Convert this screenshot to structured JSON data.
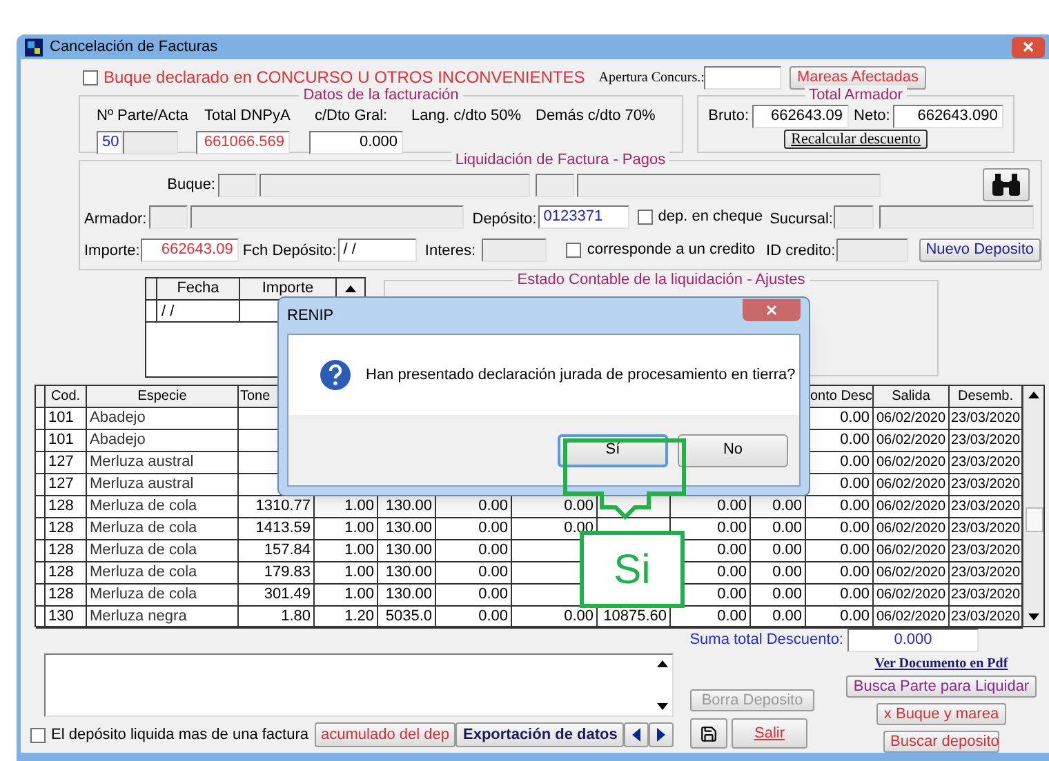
{
  "window": {
    "title": "Cancelación de Facturas"
  },
  "top_bar": {
    "concurso": {
      "label": "Buque declarado en CONCURSO U OTROS INCONVENIENTES",
      "checked": false
    },
    "apertura_label": "Apertura Concurs.:",
    "mareas_button": "Mareas Afectadas"
  },
  "datos_facturacion": {
    "title": "Datos de la facturación",
    "labels": [
      "Nº Parte/Acta",
      "Total DNPyA",
      "c/Dto Gral:",
      "Lang. c/dto 50%",
      "Demás c/dto 70%"
    ],
    "parte": "50",
    "total_dnpya": "661066.569",
    "dto_gral": "0.000"
  },
  "total_armador": {
    "title": "Total Armador",
    "bruto_label": "Bruto:",
    "bruto": "662643.09",
    "neto_label": "Neto:",
    "neto": "662643.090",
    "recalcular_button": "Recalcular descuento"
  },
  "pagos": {
    "title": "Liquidación de Factura - Pagos",
    "buque_label": "Buque:",
    "armador_label": "Armador:",
    "deposito_label": "Depósito:",
    "deposito": "0123371",
    "cheque": {
      "label": "dep. en cheque",
      "checked": false
    },
    "sucursal_label": "Sucursal:",
    "importe_label": "Importe:",
    "importe": "662643.09",
    "fecha_label": "Fch Depósito:",
    "fecha": "/ /",
    "interes_label": "Interes:",
    "credito": {
      "label": "corresponde a un credito",
      "checked": false
    },
    "id_credito_label": "ID credito:",
    "nuevo_button": "Nuevo Deposito"
  },
  "deposit_grid": {
    "columns": [
      "Fecha",
      "Importe"
    ],
    "rows": [
      {
        "fecha": "/ /"
      }
    ]
  },
  "ajustes": {
    "title": "Estado Contable de la liquidación - Ajustes"
  },
  "table": {
    "columns": [
      {
        "label": "Cod."
      },
      {
        "label": "Especie"
      },
      {
        "label": "Tone"
      },
      {},
      {},
      {},
      {},
      {},
      {},
      {},
      {
        "label": "onto Desc"
      },
      {
        "label": "Salida"
      },
      {
        "label": "Desemb."
      }
    ],
    "rows": [
      {
        "cod": "101",
        "especie": "Abadejo",
        "monto": "0.00",
        "salida": "06/02/2020",
        "desemb": "23/03/2020"
      },
      {
        "cod": "101",
        "especie": "Abadejo",
        "monto": "0.00",
        "salida": "06/02/2020",
        "desemb": "23/03/2020"
      },
      {
        "cod": "127",
        "especie": "Merluza austral",
        "monto": "0.00",
        "salida": "06/02/2020",
        "desemb": "23/03/2020"
      },
      {
        "cod": "127",
        "especie": "Merluza austral",
        "monto": "0.00",
        "salida": "06/02/2020",
        "desemb": "23/03/2020"
      },
      {
        "cod": "128",
        "especie": "Merluza de cola",
        "tone": "1310.77",
        "column_4": "1.00",
        "column_5": "130.00",
        "column_6": "0.00",
        "column_7": "0.00",
        "column_9": "0.00",
        "column_10": "0.00",
        "monto": "0.00",
        "salida": "06/02/2020",
        "desemb": "23/03/2020"
      },
      {
        "cod": "128",
        "especie": "Merluza de cola",
        "tone": "1413.59",
        "column_4": "1.00",
        "column_5": "130.00",
        "column_6": "0.00",
        "column_7": "0.00",
        "column_9": "0.00",
        "column_10": "0.00",
        "monto": "0.00",
        "salida": "06/02/2020",
        "desemb": "23/03/2020"
      },
      {
        "cod": "128",
        "especie": "Merluza de cola",
        "tone": "157.84",
        "column_4": "1.00",
        "column_5": "130.00",
        "column_6": "0.00",
        "column_9": "0.00",
        "column_10": "0.00",
        "monto": "0.00",
        "salida": "06/02/2020",
        "desemb": "23/03/2020"
      },
      {
        "cod": "128",
        "especie": "Merluza de cola",
        "tone": "179.83",
        "column_4": "1.00",
        "column_5": "130.00",
        "column_6": "0.00",
        "column_9": "0.00",
        "column_10": "0.00",
        "monto": "0.00",
        "salida": "06/02/2020",
        "desemb": "23/03/2020"
      },
      {
        "cod": "128",
        "especie": "Merluza de cola",
        "tone": "301.49",
        "column_4": "1.00",
        "column_5": "130.00",
        "column_6": "0.00",
        "column_9": "0.00",
        "column_10": "0.00",
        "monto": "0.00",
        "salida": "06/02/2020",
        "desemb": "23/03/2020"
      },
      {
        "cod": "130",
        "especie": "Merluza negra",
        "tone": "1.80",
        "column_4": "1.20",
        "column_5": "5035.0",
        "column_6": "0.00",
        "column_7": "0.00",
        "column_8": "10875.60",
        "column_9": "0.00",
        "column_10": "0.00",
        "monto": "0.00",
        "salida": "06/02/2020",
        "desemb": "23/03/2020"
      }
    ]
  },
  "suma": {
    "label": "Suma total Descuento:",
    "value": "0.000"
  },
  "bottom": {
    "multi_factura": {
      "label": "El depósito liquida mas de una factura",
      "checked": false
    },
    "acumulado_button": "acumulado del dep",
    "exportacion_button": "Exportación de datos",
    "borra_button": {
      "label": "Borra Deposito",
      "disabled": true
    },
    "salir_button": "Salir",
    "ver_pdf_link": "Ver Documento en Pdf",
    "busca_parte_button": "Busca Parte para Liquidar",
    "buque_marea_button": "x Buque y marea",
    "buscar_deposito_button": "Buscar deposito"
  },
  "dialog": {
    "title": "RENIP",
    "message": "Han presentado declaración jurada de procesamiento en tierra?",
    "buttons": [
      {
        "label": "Sí",
        "selected": true
      },
      {
        "label": "No",
        "selected": false
      }
    ]
  },
  "annotation": {
    "label": "Si"
  }
}
